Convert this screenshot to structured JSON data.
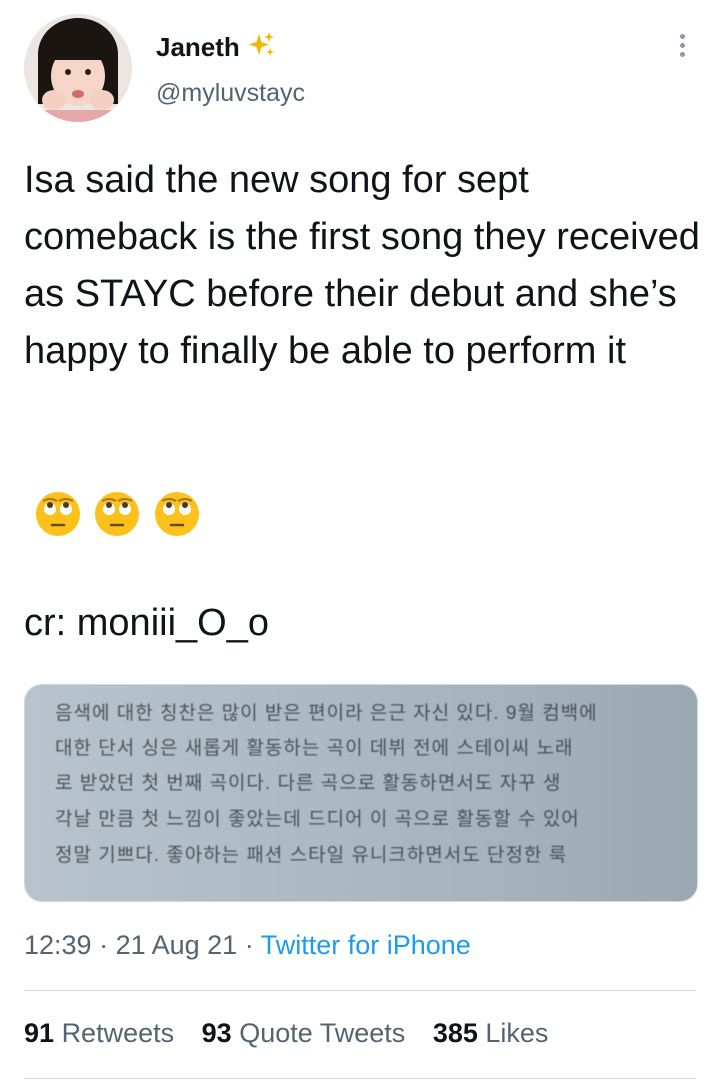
{
  "author": {
    "display_name": "Janeth",
    "handle": "@myluvstayc",
    "verified_emoji": "sparkles"
  },
  "tweet": {
    "text": "Isa said the new song for sept comeback is the first song they received as STAYC before their debut and she’s happy to finally be able to perform it",
    "emojis": [
      "face-with-rolling-eyes",
      "face-with-rolling-eyes",
      "face-with-rolling-eyes"
    ],
    "credit": "cr: moniii_O_o"
  },
  "media": {
    "lines": [
      "음색에 대한 칭찬은 많이 받은 편이라 은근 자신 있다. 9월 컴백에",
      "대한 단서 싱은 새롭게 활동하는 곡이 데뷔 전에 스테이씨 노래",
      "로 받았던 첫 번째 곡이다. 다른 곡으로 활동하면서도 자꾸 생",
      "각날 만큼 첫 느낌이 좋았는데 드디어 이 곡으로 활동할 수 있어",
      "정말 기쁘다. 좋아하는 패션 스타일 유니크하면서도 단정한 룩"
    ]
  },
  "meta": {
    "time": "12:39",
    "sep1": " · ",
    "date": "21 Aug 21",
    "sep2": " · ",
    "source": "Twitter for iPhone"
  },
  "stats": {
    "retweets_count": "91",
    "retweets_label": "Retweets",
    "quotes_count": "93",
    "quotes_label": "Quote Tweets",
    "likes_count": "385",
    "likes_label": "Likes"
  },
  "colors": {
    "text": "#0f1419",
    "secondary": "#536471",
    "link": "#1d9bf0",
    "border": "#cfd9de"
  }
}
